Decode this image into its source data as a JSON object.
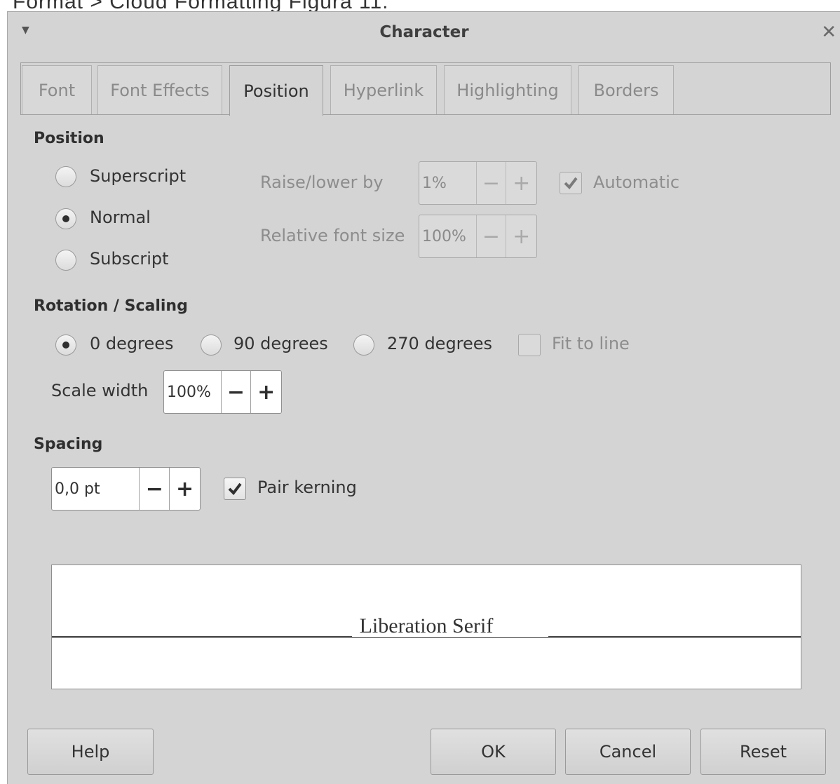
{
  "background_doc_text": "Format > Cloud Formatting  Figura 11.",
  "dialog": {
    "title": "Character",
    "menu_icon": "dropdown-triangle-icon",
    "close_symbol": "✕"
  },
  "tabs": [
    {
      "label": "Font",
      "active": false
    },
    {
      "label": "Font Effects",
      "active": false
    },
    {
      "label": "Position",
      "active": true
    },
    {
      "label": "Hyperlink",
      "active": false
    },
    {
      "label": "Highlighting",
      "active": false
    },
    {
      "label": "Borders",
      "active": false
    }
  ],
  "position_section": {
    "heading": "Position",
    "superscript_label": "Superscript",
    "normal_label": "Normal",
    "subscript_label": "Subscript",
    "selected": "Normal",
    "raise_lower_label": "Raise/lower by",
    "raise_lower_value": "1%",
    "automatic_label": "Automatic",
    "automatic_checked": true,
    "relative_font_size_label": "Relative font size",
    "relative_font_size_value": "100%"
  },
  "rotation_section": {
    "heading": "Rotation / Scaling",
    "deg0_label": "0 degrees",
    "deg90_label": "90 degrees",
    "deg270_label": "270 degrees",
    "selected": "0 degrees",
    "fit_to_line_label": "Fit to line",
    "fit_to_line_checked": false,
    "scale_width_label": "Scale width",
    "scale_width_value": "100%"
  },
  "spacing_section": {
    "heading": "Spacing",
    "spacing_value": "0,0 pt",
    "pair_kerning_label": "Pair kerning",
    "pair_kerning_checked": true
  },
  "preview": {
    "text": "Liberation Serif"
  },
  "buttons": {
    "help": "Help",
    "ok": "OK",
    "cancel": "Cancel",
    "reset": "Reset"
  },
  "spin": {
    "minus": "−",
    "plus": "+"
  }
}
